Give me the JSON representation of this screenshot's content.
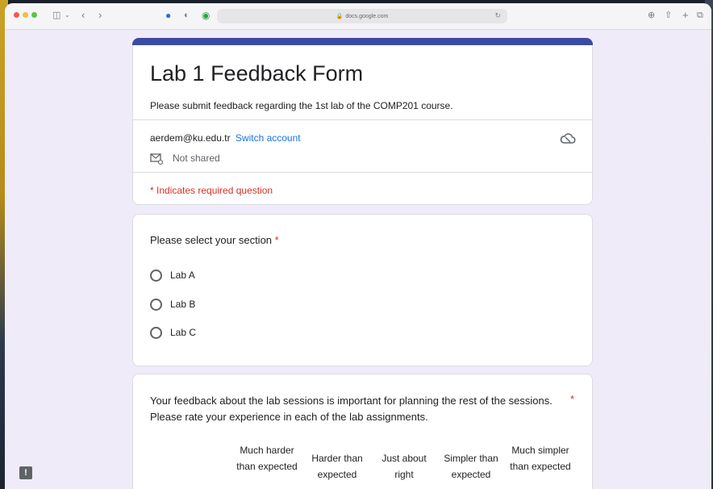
{
  "browser": {
    "url": "docs.google.com"
  },
  "form": {
    "title": "Lab 1 Feedback Form",
    "description": "Please submit feedback regarding the 1st lab of the COMP201 course.",
    "email": "aerdem@ku.edu.tr",
    "switch_account": "Switch account",
    "not_shared": "Not shared",
    "required_note": "* Indicates required question"
  },
  "question1": {
    "label": "Please select your section",
    "required_marker": "*",
    "options": [
      "Lab A",
      "Lab B",
      "Lab C"
    ]
  },
  "question2": {
    "label": "Your feedback about the lab sessions is important for planning the rest of the sessions. Please rate your experience in each of the lab assignments.",
    "required_marker": "*",
    "columns": [
      "Much harder than expected",
      "Harder than expected",
      "Just about right",
      "Simpler than expected",
      "Much simpler than expected"
    ]
  },
  "colors": {
    "accent": "#3a4ba5",
    "background": "#f0ebf8",
    "required": "#d93025",
    "link": "#1a73e8"
  }
}
